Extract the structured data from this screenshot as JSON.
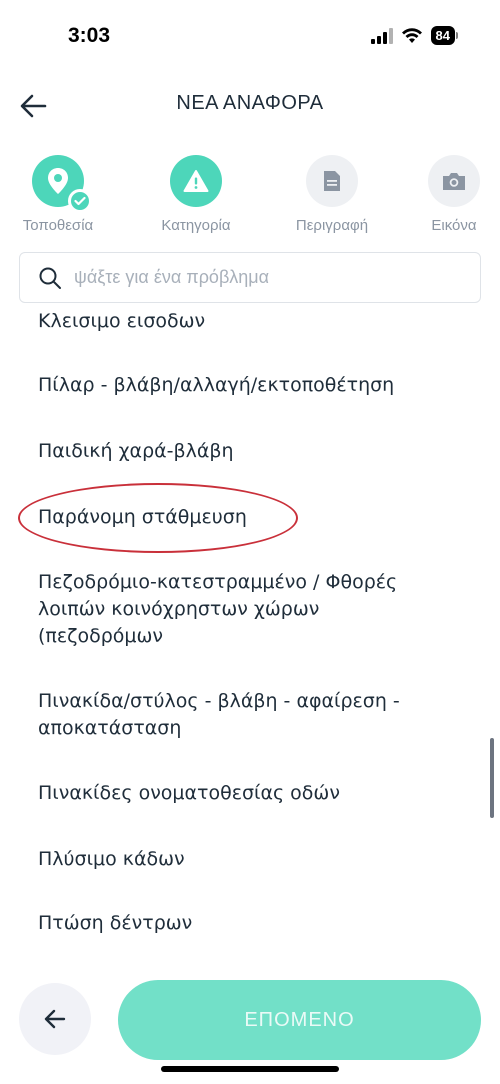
{
  "status_bar": {
    "time": "3:03",
    "battery": "84"
  },
  "header": {
    "title": "ΝΕΑ ΑΝΑΦΟΡΑ",
    "back_icon": "arrow-left-icon"
  },
  "steps": [
    {
      "label": "Τοποθεσία",
      "icon": "location-pin-icon",
      "state": "completed"
    },
    {
      "label": "Κατηγορία",
      "icon": "warning-icon",
      "state": "active"
    },
    {
      "label": "Περιγραφή",
      "icon": "document-icon",
      "state": "inactive"
    },
    {
      "label": "Εικόνα",
      "icon": "camera-icon",
      "state": "inactive"
    }
  ],
  "search": {
    "placeholder": "ψάξτε για ένα πρόβλημα"
  },
  "categories": [
    "Κλεισιμο εισοδων",
    "Πίλαρ - βλάβη/αλλαγή/εκτοποθέτηση",
    "Παιδική χαρά-βλάβη",
    "Παράνομη στάθμευση",
    "Πεζοδρόμιο-κατεστραμμένο / Φθορές λοιπών κοινόχρηστων χώρων (πεζοδρόμων",
    "Πινακίδα/στύλος - βλάβη - αφαίρεση - αποκατάσταση",
    "Πινακίδες ονοματοθεσίας οδών",
    "Πλύσιμο κάδων",
    "Πτώση δέντρων"
  ],
  "footer": {
    "next_label": "ΕΠΟΜΕΝΟ",
    "back_icon": "arrow-left-icon"
  },
  "colors": {
    "accent": "#4dd6ba",
    "next_button": "#72e0c8",
    "highlight": "#c9303a",
    "text": "#1f2d3a",
    "muted": "#8b95a2"
  }
}
